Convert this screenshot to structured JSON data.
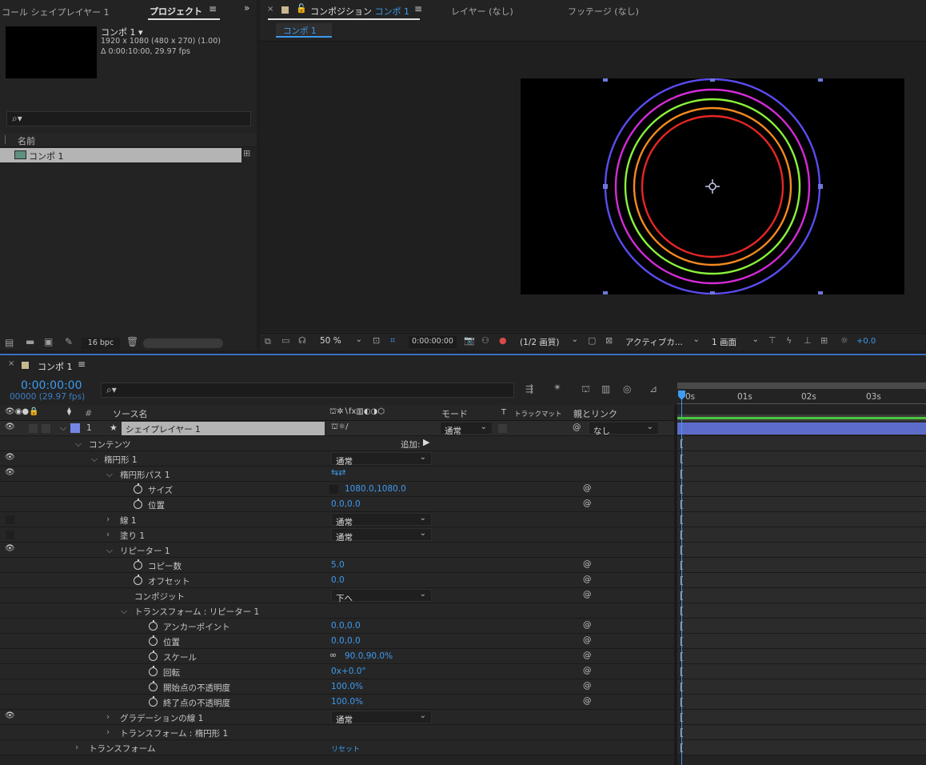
{
  "project_panel": {
    "shape_layer_tab": "コール シェイプレイヤー 1",
    "project_tab": "プロジェクト",
    "comp_name": "コンポ 1 ▾",
    "comp_size": "1920 x 1080  (480 x 270) (1.00)",
    "comp_duration": "Δ 0:00:10:00, 29.97 fps",
    "column_name": "名前",
    "items": [
      {
        "label": "コンポ 1"
      }
    ],
    "bpc": "16 bpc"
  },
  "composition_panel": {
    "tab_label": "コンポジション",
    "tab_comp": "コンポ 1",
    "layer_tab": "レイヤー (なし)",
    "footage_tab": "フッテージ (なし)",
    "subtab": "コンポ 1",
    "zoom": "50 %",
    "timecode": "0:00:00:00",
    "resolution": "(1/2 画質)",
    "camera": "アクティブカ...",
    "views": "1 画面",
    "exposure": "+0.0",
    "circle_colors": [
      "#5a4cf0",
      "#d42bd8",
      "#8af23a",
      "#f58a1e",
      "#e62626"
    ]
  },
  "timeline": {
    "tab_label": "コンポ 1",
    "timecode": "0:00:00:00",
    "fps": "00000 (29.97 fps)",
    "col_source": "ソース名",
    "col_mode": "モード",
    "col_t": "T",
    "col_trkmat": "トラックマット",
    "col_parent": "親とリンク",
    "ruler": [
      "0s",
      "01s",
      "02s",
      "03s"
    ],
    "layer": {
      "num": "1",
      "name": "シェイプレイヤー 1",
      "mode": "通常",
      "parent": "なし"
    },
    "rows": {
      "contents": "コンテンツ",
      "add": "追加:",
      "ellipse": "楕円形 1",
      "ellipse_mode": "通常",
      "ellipse_path": "楕円形パス 1",
      "size_label": "サイズ",
      "size_value": "1080.0,1080.0",
      "pos_label": "位置",
      "pos_value": "0.0,0.0",
      "stroke": "線 1",
      "stroke_mode": "通常",
      "fill": "塗り 1",
      "fill_mode": "通常",
      "repeater": "リピーター 1",
      "copies_label": "コピー数",
      "copies_value": "5.0",
      "offset_label": "オフセット",
      "offset_value": "0.0",
      "composite_label": "コンポジット",
      "composite_value": "下へ",
      "transform_rep": "トランスフォーム : リピーター 1",
      "anchor_label": "アンカーポイント",
      "anchor_value": "0.0,0.0",
      "pos2_label": "位置",
      "pos2_value": "0.0,0.0",
      "scale_label": "スケール",
      "scale_value": "90.0,90.0%",
      "rotation_label": "回転",
      "rotation_value": "0x+0.0°",
      "start_op_label": "開始点の不透明度",
      "start_op_value": "100.0%",
      "end_op_label": "終了点の不透明度",
      "end_op_value": "100.0%",
      "grad_stroke": "グラデーションの線 1",
      "grad_mode": "通常",
      "transform_ellipse": "トランスフォーム : 楕円形 1",
      "transform": "トランスフォーム",
      "reset": "リセット"
    }
  }
}
